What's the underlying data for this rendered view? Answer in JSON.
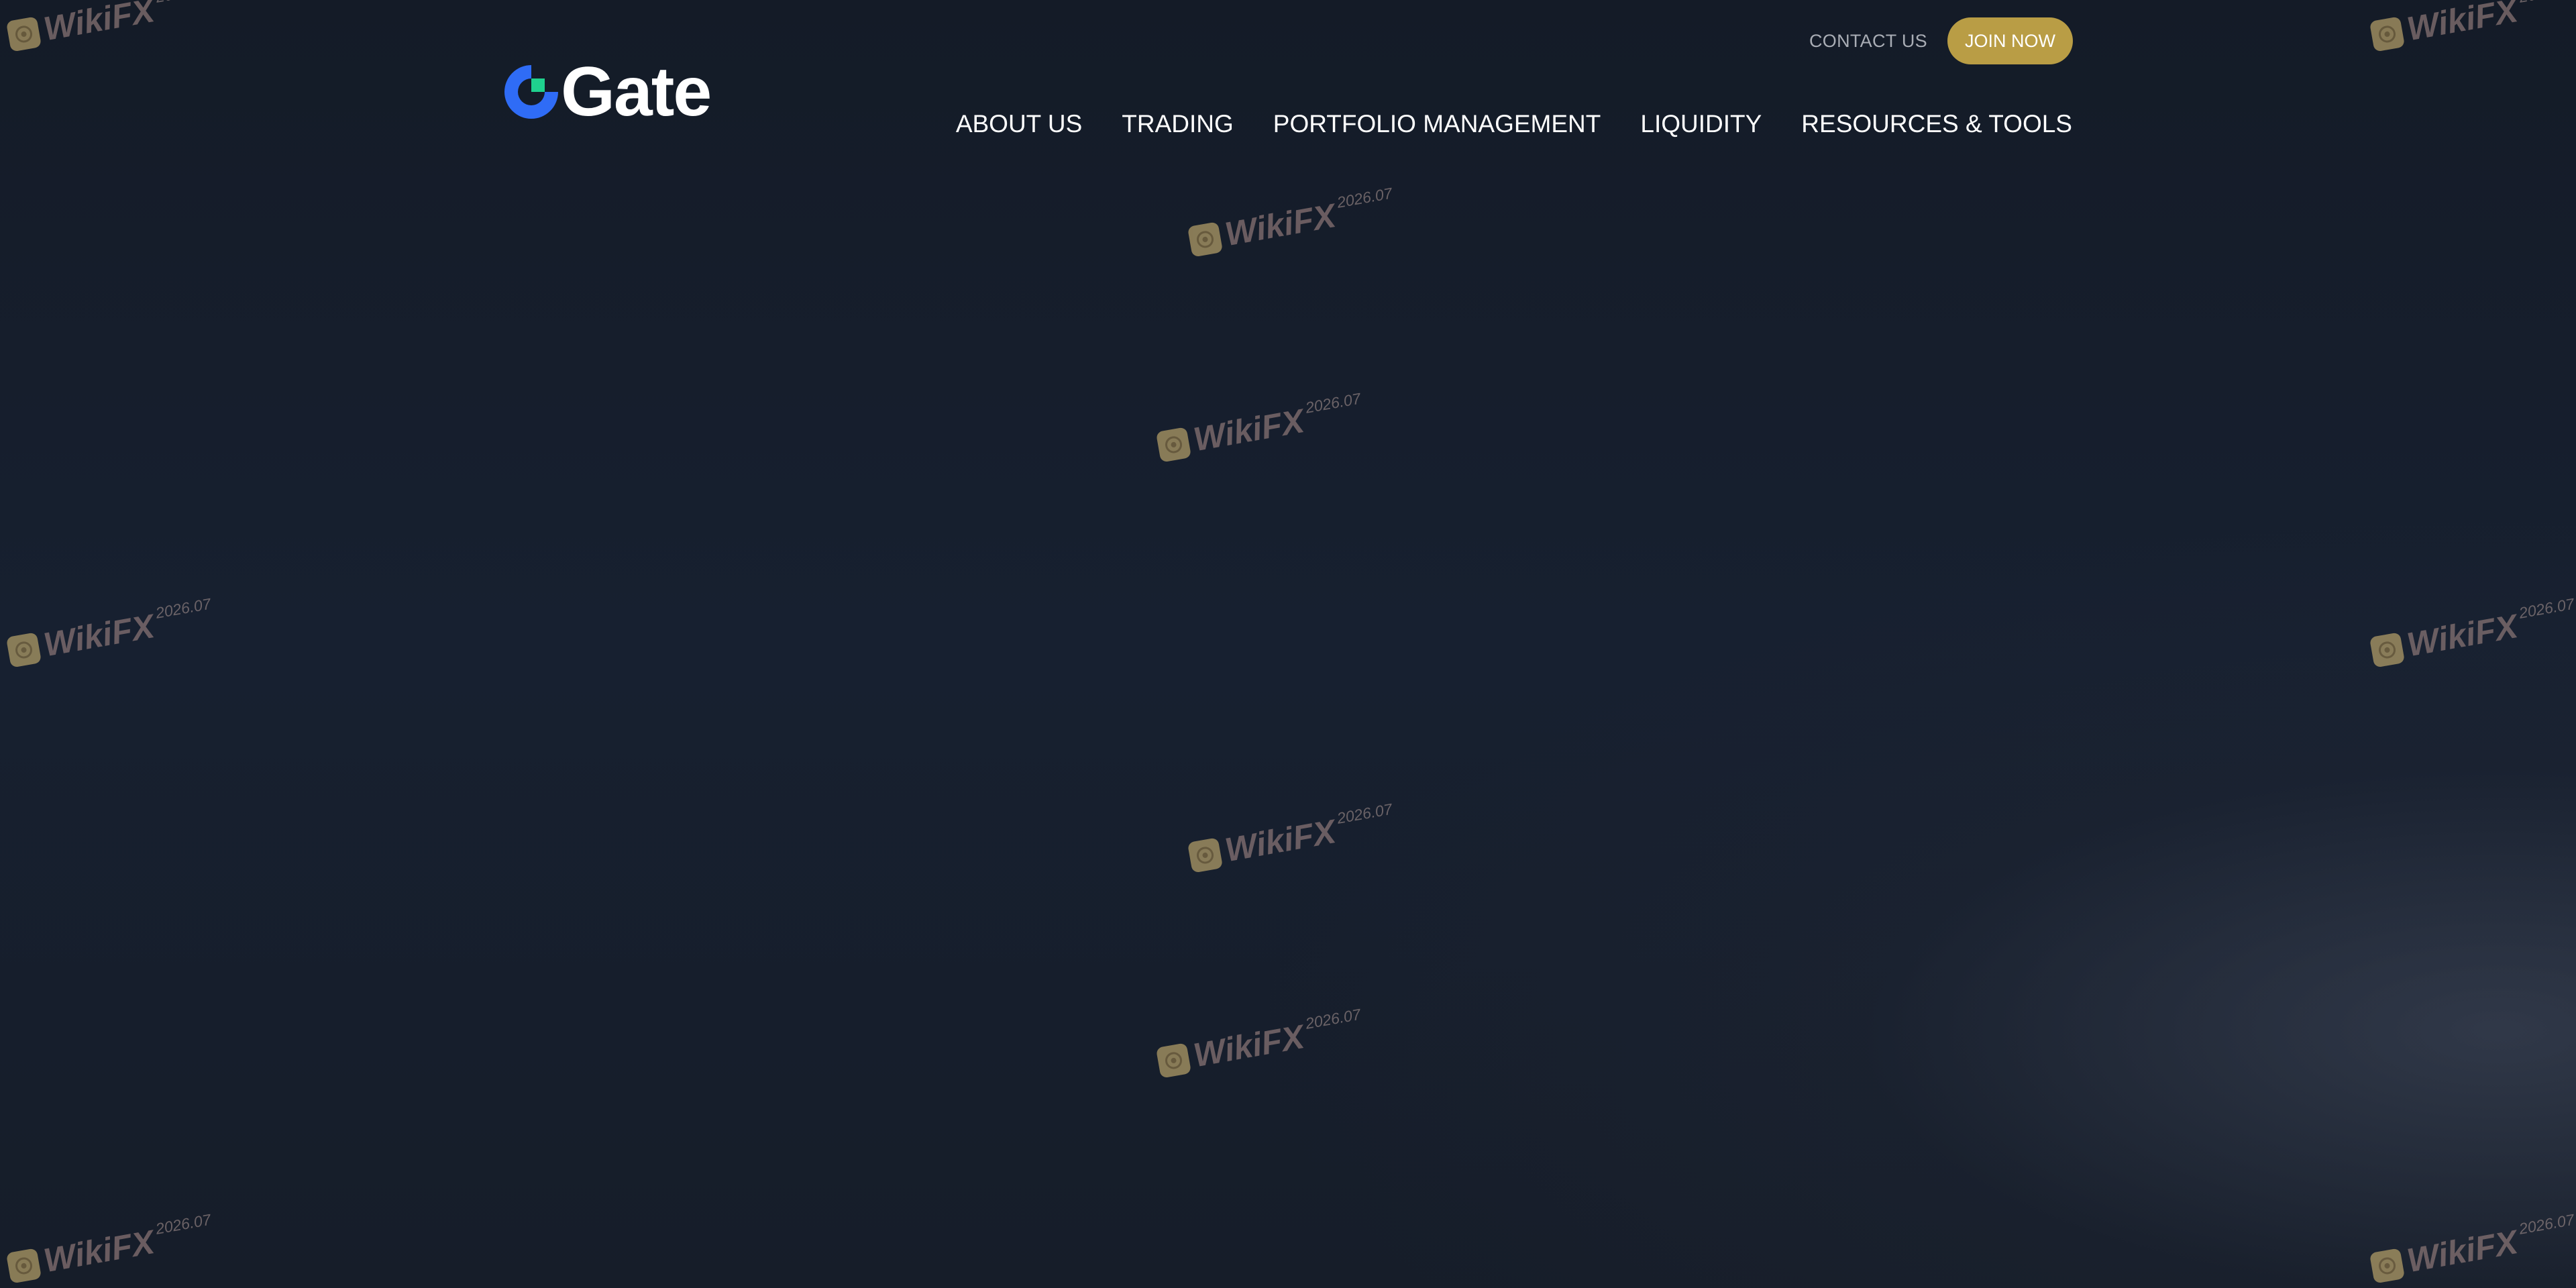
{
  "brand": {
    "name": "Gate",
    "logo_colors": {
      "ring": "#2f6cf6",
      "square": "#1fd18e",
      "text": "#ffffff"
    }
  },
  "topbar": {
    "contact_label": "CONTACT US",
    "join_label": "JOIN NOW",
    "join_color": "#b99d45"
  },
  "nav": {
    "items": [
      {
        "label": "ABOUT US"
      },
      {
        "label": "TRADING"
      },
      {
        "label": "PORTFOLIO MANAGEMENT"
      },
      {
        "label": "LIQUIDITY"
      },
      {
        "label": "RESOURCES & TOOLS"
      }
    ]
  },
  "watermark": {
    "text": "WikiFX",
    "date": "2026.07",
    "icon": "wikifx-badge-icon"
  },
  "colors": {
    "background": "#161d29",
    "accent": "#b99d45"
  }
}
